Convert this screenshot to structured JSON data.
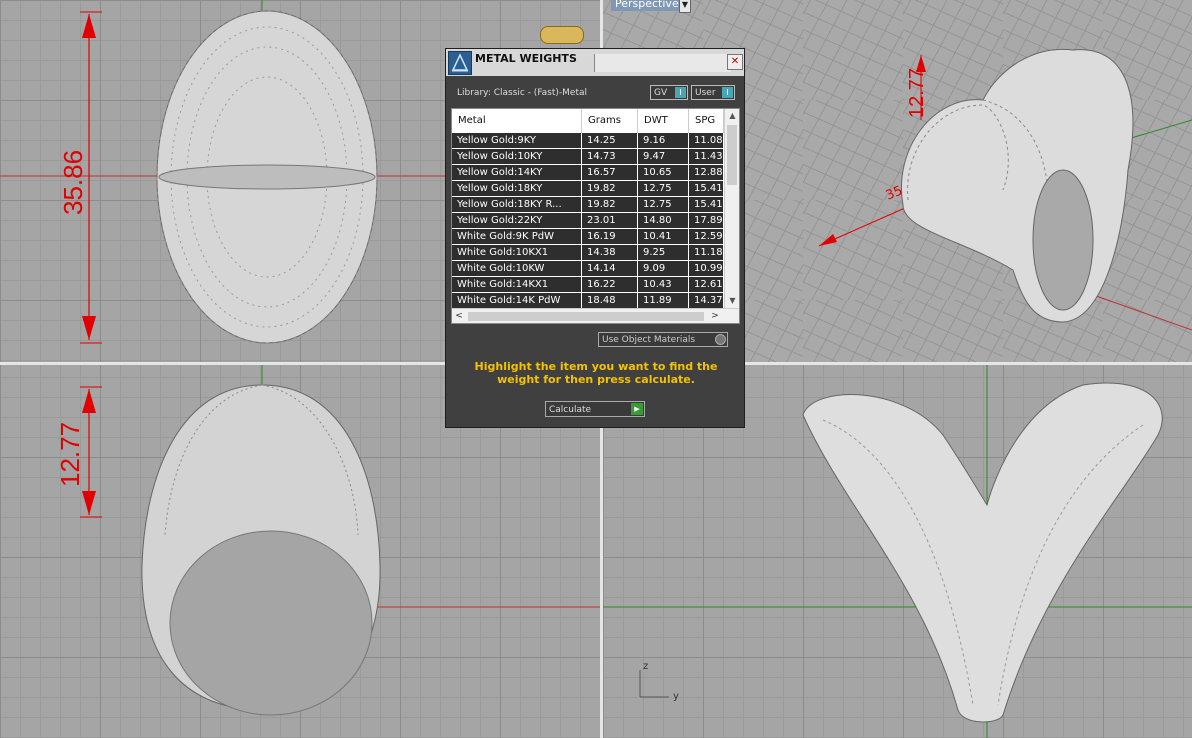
{
  "viewports": {
    "perspective_label": "Perspective",
    "perspective_menu_icon": "chevron-down-icon",
    "top_dimension": "35.86",
    "front_dimension": "12.77",
    "persp_dimension_a": "12.77",
    "persp_dimension_b": "35",
    "axis_z": "z",
    "axis_y": "y"
  },
  "dialog": {
    "title": "METAL WEIGHTS",
    "logo_icon": "gem-scale-icon",
    "close_label": "✕",
    "library_label": "Library: Classic - (Fast)-Metal",
    "toggle_gv": "GV",
    "toggle_user": "User",
    "toggle_marker": "I",
    "columns": [
      "Metal",
      "Grams",
      "DWT",
      "SPG"
    ],
    "rows": [
      [
        "Yellow Gold:9KY",
        "14.25",
        "9.16",
        "11.08"
      ],
      [
        "Yellow Gold:10KY",
        "14.73",
        "9.47",
        "11.43"
      ],
      [
        "Yellow Gold:14KY",
        "16.57",
        "10.65",
        "12.88"
      ],
      [
        "Yellow Gold:18KY",
        "19.82",
        "12.75",
        "15.41"
      ],
      [
        "Yellow Gold:18KY R...",
        "19.82",
        "12.75",
        "15.41"
      ],
      [
        "Yellow Gold:22KY",
        "23.01",
        "14.80",
        "17.89"
      ],
      [
        "White Gold:9K PdW",
        "16.19",
        "10.41",
        "12.59"
      ],
      [
        "White Gold:10KX1",
        "14.38",
        "9.25",
        "11.18"
      ],
      [
        "White Gold:10KW",
        "14.14",
        "9.09",
        "10.99"
      ],
      [
        "White Gold:14KX1",
        "16.22",
        "10.43",
        "12.61"
      ],
      [
        "White Gold:14K PdW",
        "18.48",
        "11.89",
        "14.37"
      ]
    ],
    "scroll_up": "▲",
    "scroll_down": "▼",
    "scroll_left": "<",
    "scroll_right": ">",
    "use_object_materials": "Use Object Materials",
    "hint": "Highlight the item you want to find the weight for then press calculate.",
    "calculate_label": "Calculate",
    "calculate_marker": "▶"
  }
}
